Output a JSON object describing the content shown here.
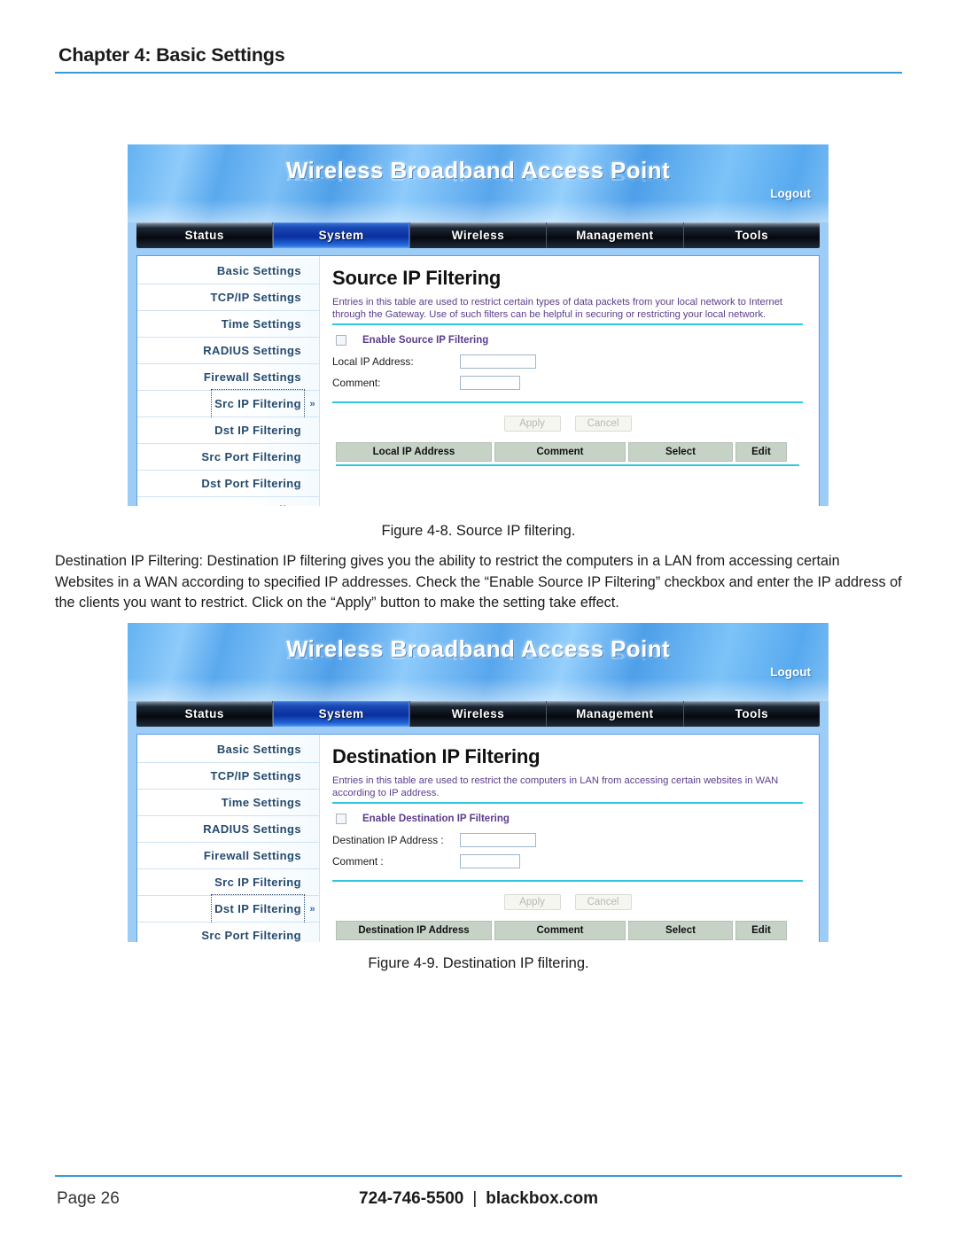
{
  "page": {
    "chapter_title": "Chapter 4: Basic Settings",
    "footer_page": "Page 26",
    "footer_phone": "724-746-5500",
    "footer_separator": "|",
    "footer_site": "blackbox.com"
  },
  "captions": {
    "figure_1": "Figure 4-8. Source IP filtering.",
    "figure_2": "Figure 4-9. Destination IP filtering."
  },
  "paragraph": "Destination IP Filtering: Destination IP filtering gives you the ability to restrict the computers in a LAN from accessing certain Websites in a WAN according to specified IP addresses. Check the “Enable Source IP Filtering” checkbox and enter the IP address of the clients you want to restrict. Click on the “Apply” button to make the setting take effect.",
  "screenshot_1": {
    "banner_title": "Wireless Broadband Access Point",
    "logout_label": "Logout",
    "tabs": [
      {
        "label": "Status",
        "active": false
      },
      {
        "label": "System",
        "active": true
      },
      {
        "label": "Wireless",
        "active": false
      },
      {
        "label": "Management",
        "active": false
      },
      {
        "label": "Tools",
        "active": false
      }
    ],
    "sidebar": [
      {
        "label": "Basic Settings",
        "selected": false
      },
      {
        "label": "TCP/IP Settings",
        "selected": false
      },
      {
        "label": "Time Settings",
        "selected": false
      },
      {
        "label": "RADIUS Settings",
        "selected": false
      },
      {
        "label": "Firewall Settings",
        "selected": false
      },
      {
        "label": "Src IP Filtering",
        "selected": true
      },
      {
        "label": "Dst IP Filtering",
        "selected": false
      },
      {
        "label": "Src Port Filtering",
        "selected": false
      },
      {
        "label": "Dst Port Filtering",
        "selected": false
      },
      {
        "label": "Port Forwarding",
        "selected": false
      }
    ],
    "chevron": "»",
    "heading": "Source IP Filtering",
    "description": "Entries in this table are used to restrict certain types of data packets from your local network to Internet through the Gateway. Use of such filters can be helpful in securing or restricting your local network.",
    "checkbox_label": "Enable Source IP Filtering",
    "field_ip_label": "Local IP Address:",
    "field_ip_value": "",
    "field_comment_label": "Comment:",
    "field_comment_value": "",
    "apply_label": "Apply",
    "cancel_label": "Cancel",
    "table_headers": [
      "Local IP Address",
      "Comment",
      "Select",
      "Edit"
    ]
  },
  "screenshot_2": {
    "banner_title": "Wireless Broadband Access Point",
    "logout_label": "Logout",
    "tabs": [
      {
        "label": "Status",
        "active": false
      },
      {
        "label": "System",
        "active": true
      },
      {
        "label": "Wireless",
        "active": false
      },
      {
        "label": "Management",
        "active": false
      },
      {
        "label": "Tools",
        "active": false
      }
    ],
    "sidebar": [
      {
        "label": "Basic Settings",
        "selected": false
      },
      {
        "label": "TCP/IP Settings",
        "selected": false
      },
      {
        "label": "Time Settings",
        "selected": false
      },
      {
        "label": "RADIUS Settings",
        "selected": false
      },
      {
        "label": "Firewall Settings",
        "selected": false
      },
      {
        "label": "Src IP Filtering",
        "selected": false
      },
      {
        "label": "Dst IP Filtering",
        "selected": true
      },
      {
        "label": "Src Port Filtering",
        "selected": false
      }
    ],
    "chevron": "»",
    "heading": "Destination IP Filtering",
    "description": "Entries in this table are used to restrict the computers in LAN from accessing certain websites in WAN according to IP address.",
    "checkbox_label": "Enable Destination IP Filtering",
    "field_ip_label": "Destination IP Address :",
    "field_ip_value": "",
    "field_comment_label": "Comment :",
    "field_comment_value": "",
    "apply_label": "Apply",
    "cancel_label": "Cancel",
    "table_headers": [
      "Destination IP Address",
      "Comment",
      "Select",
      "Edit"
    ]
  },
  "colors": {
    "accent_rule": "#3a9ad9",
    "router_cyan_rule": "#2fc6de",
    "router_bg_blue": "#9dccf7",
    "active_tab_blue": "#0b2f9e",
    "menu_text": "#244a6e",
    "desc_text": "#5b3d8c"
  }
}
